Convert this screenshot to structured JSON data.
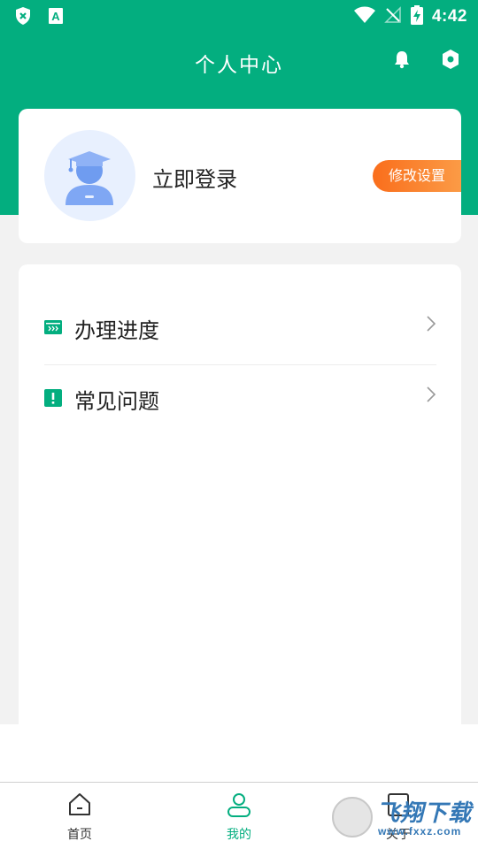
{
  "status_bar": {
    "time": "4:42"
  },
  "header": {
    "title": "个人中心"
  },
  "profile": {
    "login_text": "立即登录",
    "modify_button": "修改设置"
  },
  "menu": {
    "items": [
      {
        "label": "办理进度",
        "icon": "progress-icon"
      },
      {
        "label": "常见问题",
        "icon": "faq-icon"
      }
    ]
  },
  "bottom_nav": {
    "items": [
      {
        "label": "首页",
        "icon": "home-icon",
        "active": false
      },
      {
        "label": "我的",
        "icon": "user-icon",
        "active": true
      },
      {
        "label": "关于",
        "icon": "info-icon",
        "active": false
      }
    ]
  },
  "watermark": {
    "text": "飞翔下载",
    "url": "www.fxxz.com"
  },
  "colors": {
    "primary": "#03ae7f",
    "accent_orange": "#fa6e1c",
    "avatar_blue": "#6f9cf0"
  }
}
